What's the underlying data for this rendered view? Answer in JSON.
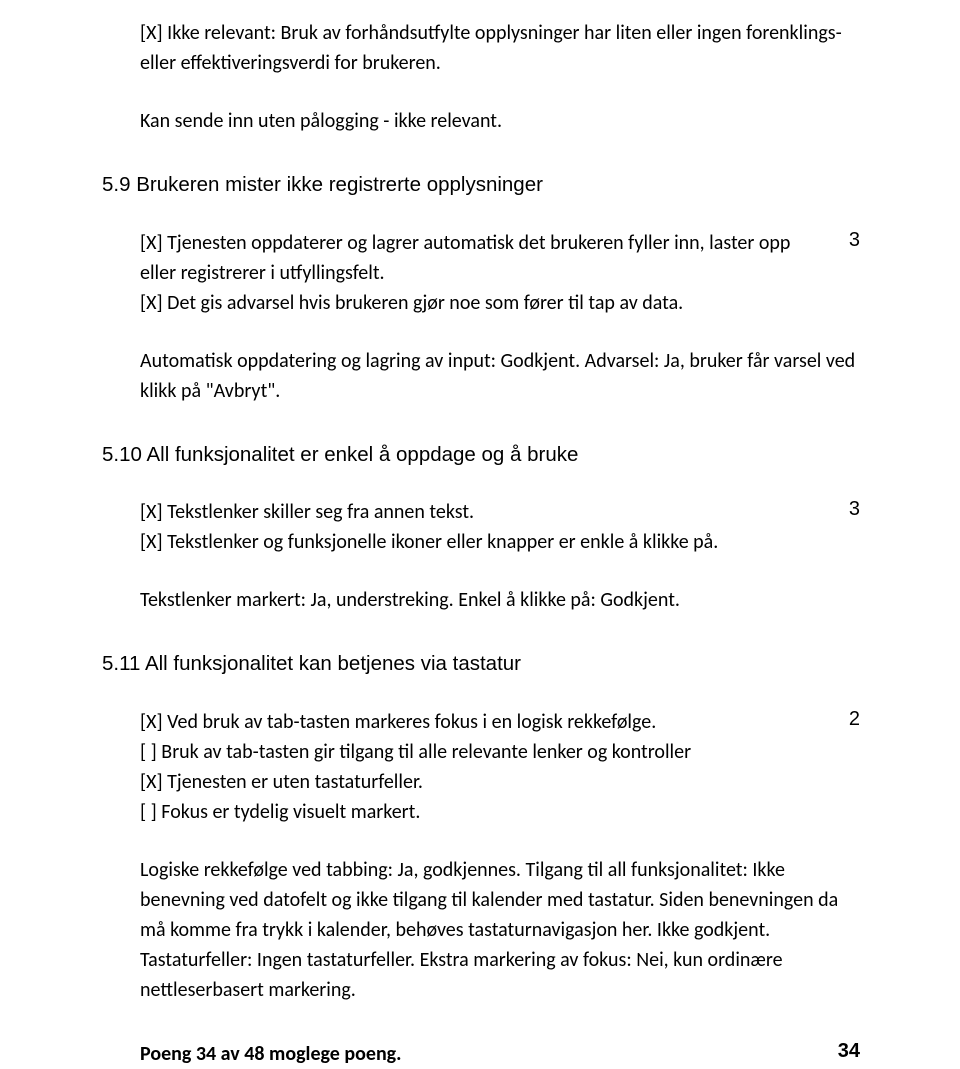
{
  "intro": {
    "l1": "[X] Ikke relevant: Bruk av forhåndsutfylte opplysninger har liten eller ingen forenklings- eller effektiveringsverdi for brukeren.",
    "l2": "Kan sende inn uten pålogging - ikke relevant."
  },
  "s59": {
    "title": "5.9 Brukeren mister ikke registrerte opplysninger",
    "c1": "[X] Tjenesten oppdaterer og lagrer automatisk det brukeren fyller inn, laster opp eller registrerer i utfyllingsfelt.",
    "c2": "[X] Det gis advarsel hvis brukeren gjør noe som fører til tap av data.",
    "score": "3",
    "note": "Automatisk oppdatering og lagring av input: Godkjent. Advarsel: Ja, bruker får varsel ved klikk på \"Avbryt\"."
  },
  "s510": {
    "title": "5.10 All funksjonalitet er enkel å oppdage og å bruke",
    "c1": "[X] Tekstlenker skiller seg fra annen tekst.",
    "c2": "[X] Tekstlenker og funksjonelle ikoner eller knapper er enkle å klikke på.",
    "score": "3",
    "note": "Tekstlenker markert: Ja, understreking. Enkel å klikke på: Godkjent."
  },
  "s511": {
    "title": "5.11 All funksjonalitet kan betjenes via tastatur",
    "c1": "[X] Ved bruk av tab-tasten markeres fokus i en logisk rekkefølge.",
    "c2": "[ ] Bruk av tab-tasten gir tilgang til alle relevante lenker og kontroller",
    "c3": "[X] Tjenesten er uten tastaturfeller.",
    "c4": "[ ] Fokus er tydelig visuelt markert.",
    "score": "2",
    "note": "Logiske rekkefølge ved tabbing: Ja, godkjennes. Tilgang til all funksjonalitet: Ikke benevning ved datofelt og ikke tilgang til kalender med tastatur. Siden benevningen da må komme fra trykk i kalender, behøves tastaturnavigasjon her. Ikke godkjent. Tastaturfeller: Ingen tastaturfeller. Ekstra markering av fokus: Nei, kun ordinære nettleserbasert markering."
  },
  "footer": {
    "label": "Poeng 34 av 48 moglege poeng.",
    "total": "34"
  }
}
